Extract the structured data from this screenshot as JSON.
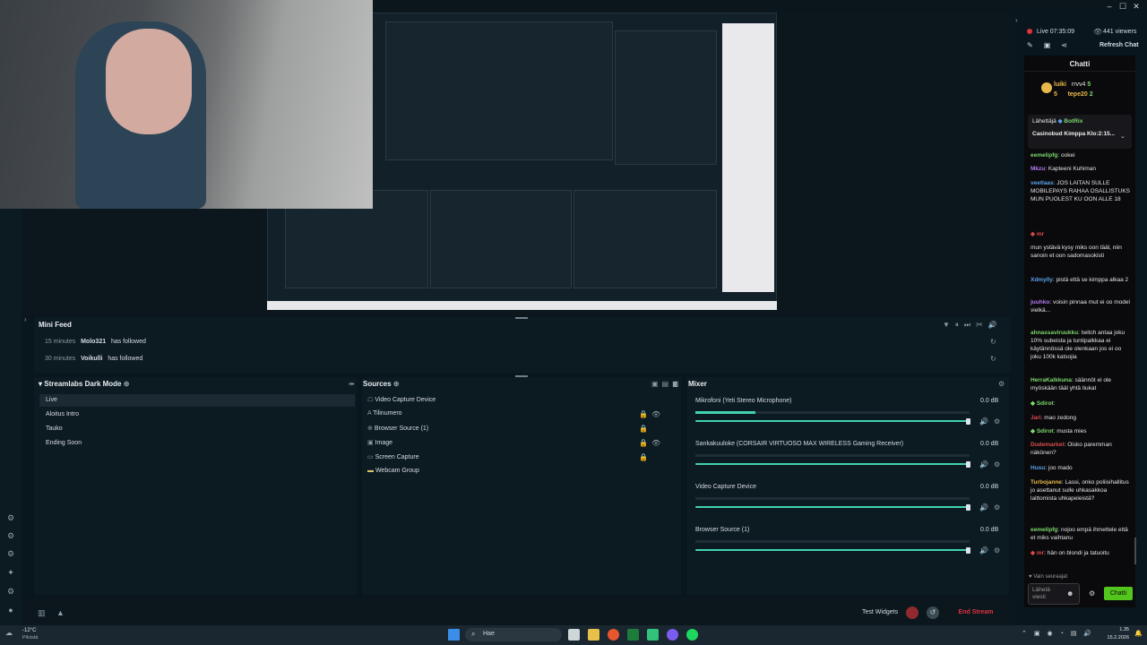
{
  "stream": {
    "live": "Live 07:35:09",
    "viewers": "441 viewers",
    "refresh": "Refresh Chat"
  },
  "minifeed": {
    "title": "Mini Feed",
    "items": [
      {
        "time": "15 minutes",
        "user": "Molo321",
        "action": "has followed"
      },
      {
        "time": "30 minutes",
        "user": "Voikulli",
        "action": "has followed"
      }
    ]
  },
  "scenes": {
    "title": "Streamlabs Dark Mode",
    "items": [
      "Live",
      "Aloitus Intro",
      "Tauko",
      "Ending Soon"
    ]
  },
  "sources": {
    "title": "Sources",
    "items": [
      "Video Capture Device",
      "Tilinumero",
      "Browser Source (1)",
      "Image",
      "Screen Capture",
      "Webcam Group"
    ]
  },
  "mixer": {
    "title": "Mixer",
    "channels": [
      {
        "name": "Mikrofoni (Yeti Stereo Microphone)",
        "db": "0.0 dB"
      },
      {
        "name": "Sankakuuloke (CORSAIR VIRTUOSO MAX WIRELESS Gaming Receiver)",
        "db": "0.0 dB"
      },
      {
        "name": "Video Capture Device",
        "db": "0.0 dB"
      },
      {
        "name": "Browser Source (1)",
        "db": "0.0 dB"
      }
    ]
  },
  "footer": {
    "test_widgets": "Test Widgets",
    "end_stream": "End Stream"
  },
  "chat": {
    "title": "Chatti",
    "top_users": [
      "luiki",
      "rrvv4",
      "tepe20"
    ],
    "top_counts": [
      "5",
      "5",
      "2"
    ],
    "pinned_sender": "Lähettäjä",
    "pinned_bot": "BotRix",
    "pinned_text": "Casinobud Kimppa Klo:2:15...",
    "messages": [
      {
        "user": "eemelipfg",
        "text": "ookei"
      },
      {
        "user": "Mkzu",
        "text": "Kapteeni Kuhiman"
      },
      {
        "user": "veetlaas",
        "text": "JOS LAITAN SULLE MOBILEPAYS RAHAA OSALLISTUKS MUN PUOLEST KU OON ALLE 18"
      },
      {
        "user": "mr",
        "text": "mun ystävä kysy miks oon tääl, niin sanoin et oon sadomasokisti"
      },
      {
        "user": "Xdmylly",
        "text": "pistä että se kimppa alkaa 2"
      },
      {
        "user": "juuhko",
        "text": "voisin pinnaa mut ei oo model vielkä..."
      },
      {
        "user": "ahnassaviruukku",
        "text": "twitch antaa joku 10% subeista ja tuntipalkkaa ei käytännössä ole olenkaan jos ei oo joku 100k katsojia"
      },
      {
        "user": "HerraKalkkuna",
        "text": "säännöt ei ole myöskään tääl yhtä tiukat"
      },
      {
        "user": "Sdirot",
        "text": ""
      },
      {
        "user": "Jari",
        "text": "mao zedong"
      },
      {
        "user": "Sdirot",
        "text": "musta mies"
      },
      {
        "user": "Dudemarket",
        "text": "Oisko paremman näkönen?"
      },
      {
        "user": "Husu",
        "text": "joo mado"
      },
      {
        "user": "Turbojanne",
        "text": "Lassi, onko poliisihallitus jo asettanut sulle uhkasakkoa laittomista uhkapeleistä?"
      },
      {
        "user": "eemelipfg",
        "text": "nojoo empä ihmettele että et miks vaihtanu"
      },
      {
        "user": "mr",
        "text": "hän on blondi ja tatuoitu"
      }
    ],
    "follow_only": "Vain seuraajat",
    "input_placeholder": "Lähetä viesti",
    "send": "Chatti"
  },
  "taskbar": {
    "weather": "-12°C",
    "weather_sub": "Pilvistä",
    "search": "Hae",
    "time": "1.35",
    "date": "15.2.2026"
  },
  "colors": {
    "accent": "#43d2b0",
    "end_stream": "#e0323c",
    "send_button": "#53c61d"
  }
}
